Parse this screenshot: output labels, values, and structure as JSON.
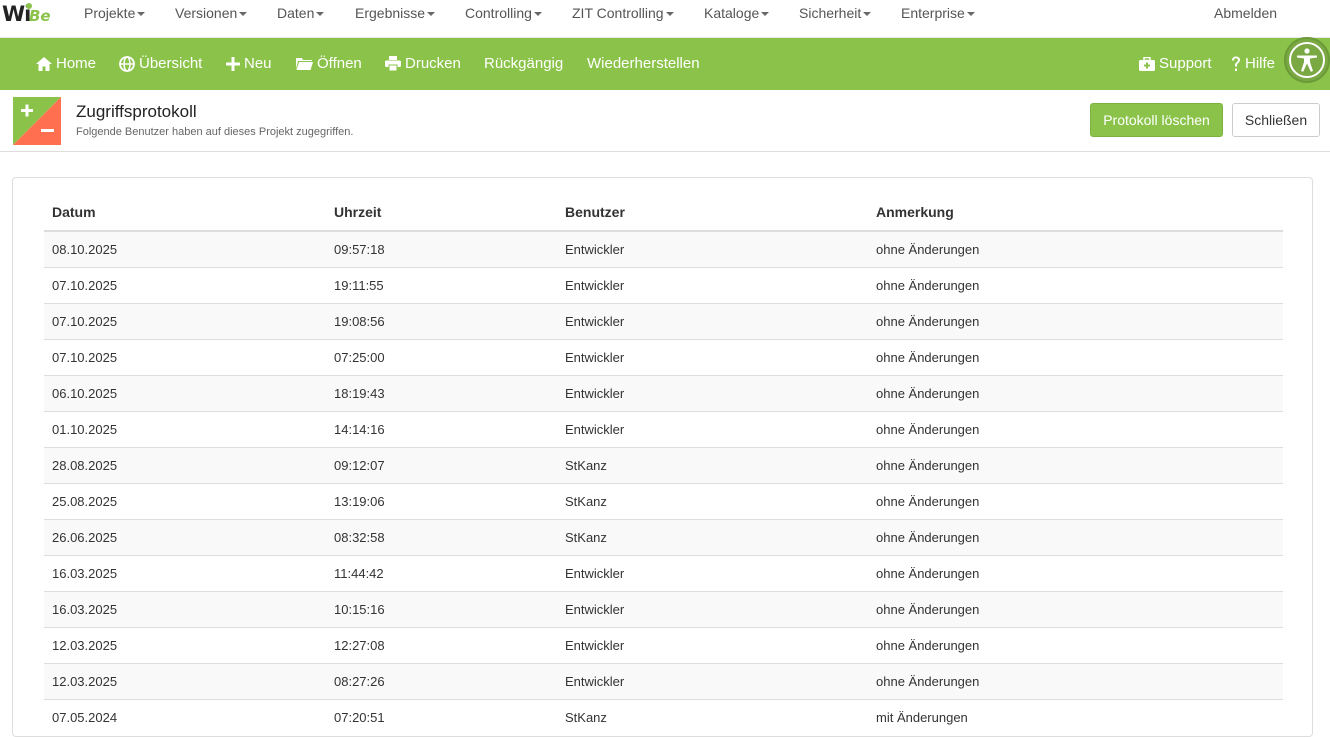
{
  "app": {
    "logo_main": "Wi",
    "logo_accent": "Be"
  },
  "menu": [
    {
      "label": "Projekte",
      "has_caret": true
    },
    {
      "label": "Versionen",
      "has_caret": true
    },
    {
      "label": "Daten",
      "has_caret": true
    },
    {
      "label": "Ergebnisse",
      "has_caret": true
    },
    {
      "label": "Controlling",
      "has_caret": true
    },
    {
      "label": "ZIT Controlling",
      "has_caret": true
    },
    {
      "label": "Kataloge",
      "has_caret": true
    },
    {
      "label": "Sicherheit",
      "has_caret": true
    },
    {
      "label": "Enterprise",
      "has_caret": true
    }
  ],
  "logout_label": "Abmelden",
  "toolbar": {
    "home": "Home",
    "overview": "Übersicht",
    "new": "Neu",
    "open": "Öffnen",
    "print": "Drucken",
    "undo": "Rückgängig",
    "redo": "Wiederherstellen",
    "support": "Support",
    "help": "Hilfe"
  },
  "page": {
    "title": "Zugriffsprotokoll",
    "subtitle": "Folgende Benutzer haben auf dieses Projekt zugegriffen.",
    "delete_button": "Protokoll löschen",
    "close_button": "Schließen"
  },
  "table": {
    "headers": {
      "date": "Datum",
      "time": "Uhrzeit",
      "user": "Benutzer",
      "note": "Anmerkung"
    },
    "rows": [
      {
        "date": "08.10.2025",
        "time": "09:57:18",
        "user": "Entwickler",
        "note": "ohne Änderungen"
      },
      {
        "date": "07.10.2025",
        "time": "19:11:55",
        "user": "Entwickler",
        "note": "ohne Änderungen"
      },
      {
        "date": "07.10.2025",
        "time": "19:08:56",
        "user": "Entwickler",
        "note": "ohne Änderungen"
      },
      {
        "date": "07.10.2025",
        "time": "07:25:00",
        "user": "Entwickler",
        "note": "ohne Änderungen"
      },
      {
        "date": "06.10.2025",
        "time": "18:19:43",
        "user": "Entwickler",
        "note": "ohne Änderungen"
      },
      {
        "date": "01.10.2025",
        "time": "14:14:16",
        "user": "Entwickler",
        "note": "ohne Änderungen"
      },
      {
        "date": "28.08.2025",
        "time": "09:12:07",
        "user": "StKanz",
        "note": "ohne Änderungen"
      },
      {
        "date": "25.08.2025",
        "time": "13:19:06",
        "user": "StKanz",
        "note": "ohne Änderungen"
      },
      {
        "date": "26.06.2025",
        "time": "08:32:58",
        "user": "StKanz",
        "note": "ohne Änderungen"
      },
      {
        "date": "16.03.2025",
        "time": "11:44:42",
        "user": "Entwickler",
        "note": "ohne Änderungen"
      },
      {
        "date": "16.03.2025",
        "time": "10:15:16",
        "user": "Entwickler",
        "note": "ohne Änderungen"
      },
      {
        "date": "12.03.2025",
        "time": "12:27:08",
        "user": "Entwickler",
        "note": "ohne Änderungen"
      },
      {
        "date": "12.03.2025",
        "time": "08:27:26",
        "user": "Entwickler",
        "note": "ohne Änderungen"
      },
      {
        "date": "07.05.2024",
        "time": "07:20:51",
        "user": "StKanz",
        "note": "mit Änderungen"
      }
    ]
  },
  "colors": {
    "accent": "#8bc34a",
    "header_icon_green": "#8bc34a",
    "header_icon_red": "#ff6f50"
  }
}
